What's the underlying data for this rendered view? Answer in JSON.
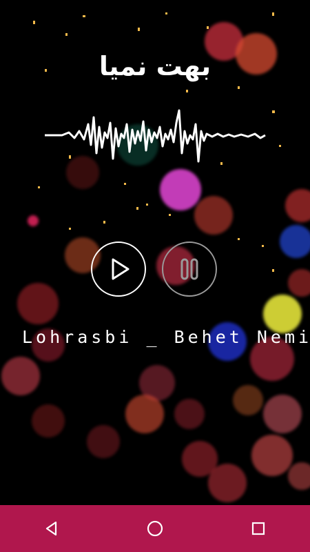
{
  "app": {
    "title": "بهت نمیا",
    "track_name": "Lohrasbi _ Behet Nemiad"
  },
  "controls": {
    "play_icon": "play-icon",
    "pause_icon": "pause-icon"
  },
  "navbar": {
    "color": "#b0174d",
    "back_icon": "back-triangle-icon",
    "home_icon": "home-circle-icon",
    "recents_icon": "recents-square-icon"
  },
  "colors": {
    "background": "#000000",
    "text": "#ffffff",
    "pause_ring": "#9a9a9a"
  }
}
